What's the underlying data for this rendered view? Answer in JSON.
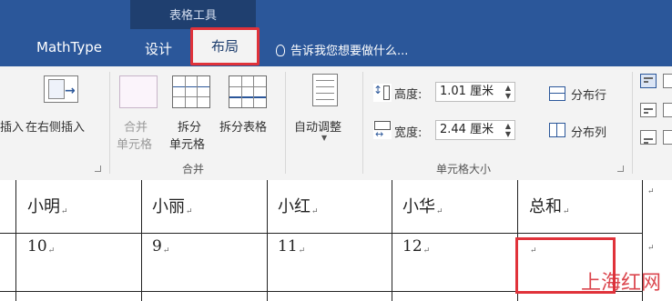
{
  "tabs": {
    "context_title": "表格工具",
    "mathtype": "MathType",
    "design": "设计",
    "layout": "布局",
    "tellme": "告诉我您想要做什么..."
  },
  "ribbon": {
    "insert_left_partial": "插入",
    "insert_right": "在右侧插入",
    "merge_cells_line1": "合并",
    "merge_cells_line2": "单元格",
    "split_cells_line1": "拆分",
    "split_cells_line2": "单元格",
    "split_table": "拆分表格",
    "merge_group": "合并",
    "autofit": "自动调整",
    "height_label": "高度:",
    "height_value": "1.01 厘米",
    "width_label": "宽度:",
    "width_value": "2.44 厘米",
    "distribute_rows": "分布行",
    "distribute_cols": "分布列",
    "cell_size_group": "单元格大小"
  },
  "table": {
    "headers": [
      "小明",
      "小丽",
      "小红",
      "小华",
      "总和"
    ],
    "row1": [
      "10",
      "9",
      "11",
      "12",
      ""
    ]
  },
  "watermark": "上海红网",
  "colors": {
    "ribbon_bar": "#2b579a",
    "highlight": "#e0323a"
  }
}
